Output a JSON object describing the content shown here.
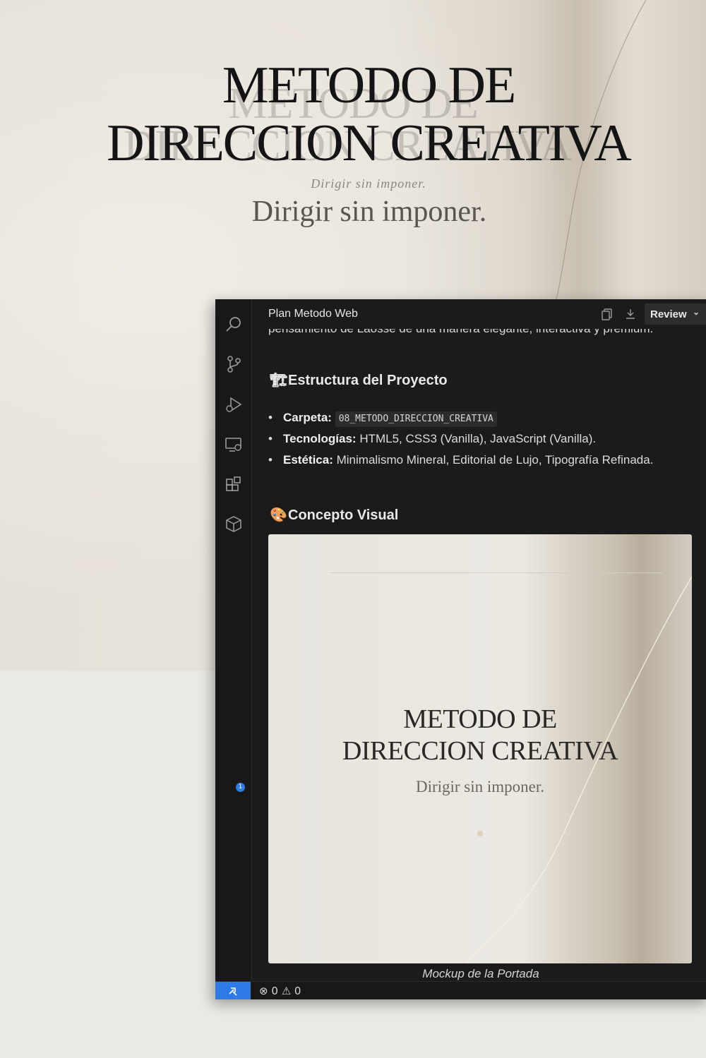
{
  "hero": {
    "title_line1": "METODO DE",
    "title_line2": "DIRECCION CREATIVA",
    "subtitle_small": "Dirigir sin imponer.",
    "subtitle": "Dirigir sin imponer."
  },
  "editor": {
    "doc_title": "Plan Metodo Web",
    "review_label": "Review",
    "cut_text": "pensamiento de Laosse de una manera elegante, interactiva y premium.",
    "sections": {
      "estructura": {
        "emoji": "🏗",
        "heading": "Estructura del Proyecto"
      },
      "concepto": {
        "emoji": "🎨",
        "heading": "Concepto Visual"
      }
    },
    "bullets": [
      {
        "label": "Carpeta:",
        "code": "08_METODO_DIRECCION_CREATIVA"
      },
      {
        "label": "Tecnologías:",
        "text": "HTML5, CSS3 (Vanilla), JavaScript (Vanilla)."
      },
      {
        "label": "Estética:",
        "text": "Minimalismo Mineral, Editorial de Lujo, Tipografía Refinada."
      }
    ],
    "mockup": {
      "title_line1": "METODO DE",
      "title_line2": "DIRECCION CREATIVA",
      "subtitle": "Dirigir sin imponer.",
      "caption": "Mockup de la Portada"
    },
    "activity_bar": {
      "icons": [
        "search-icon",
        "source-control-icon",
        "run-debug-icon",
        "remote-explorer-icon",
        "extensions-icon",
        "package-icon"
      ],
      "extensions_badge": "1"
    },
    "header_icons": [
      "copy-icon",
      "download-icon"
    ],
    "status": {
      "errors": "0",
      "warnings": "0"
    },
    "colors": {
      "accent": "#2f7be5",
      "background": "#1b1b1b"
    }
  }
}
